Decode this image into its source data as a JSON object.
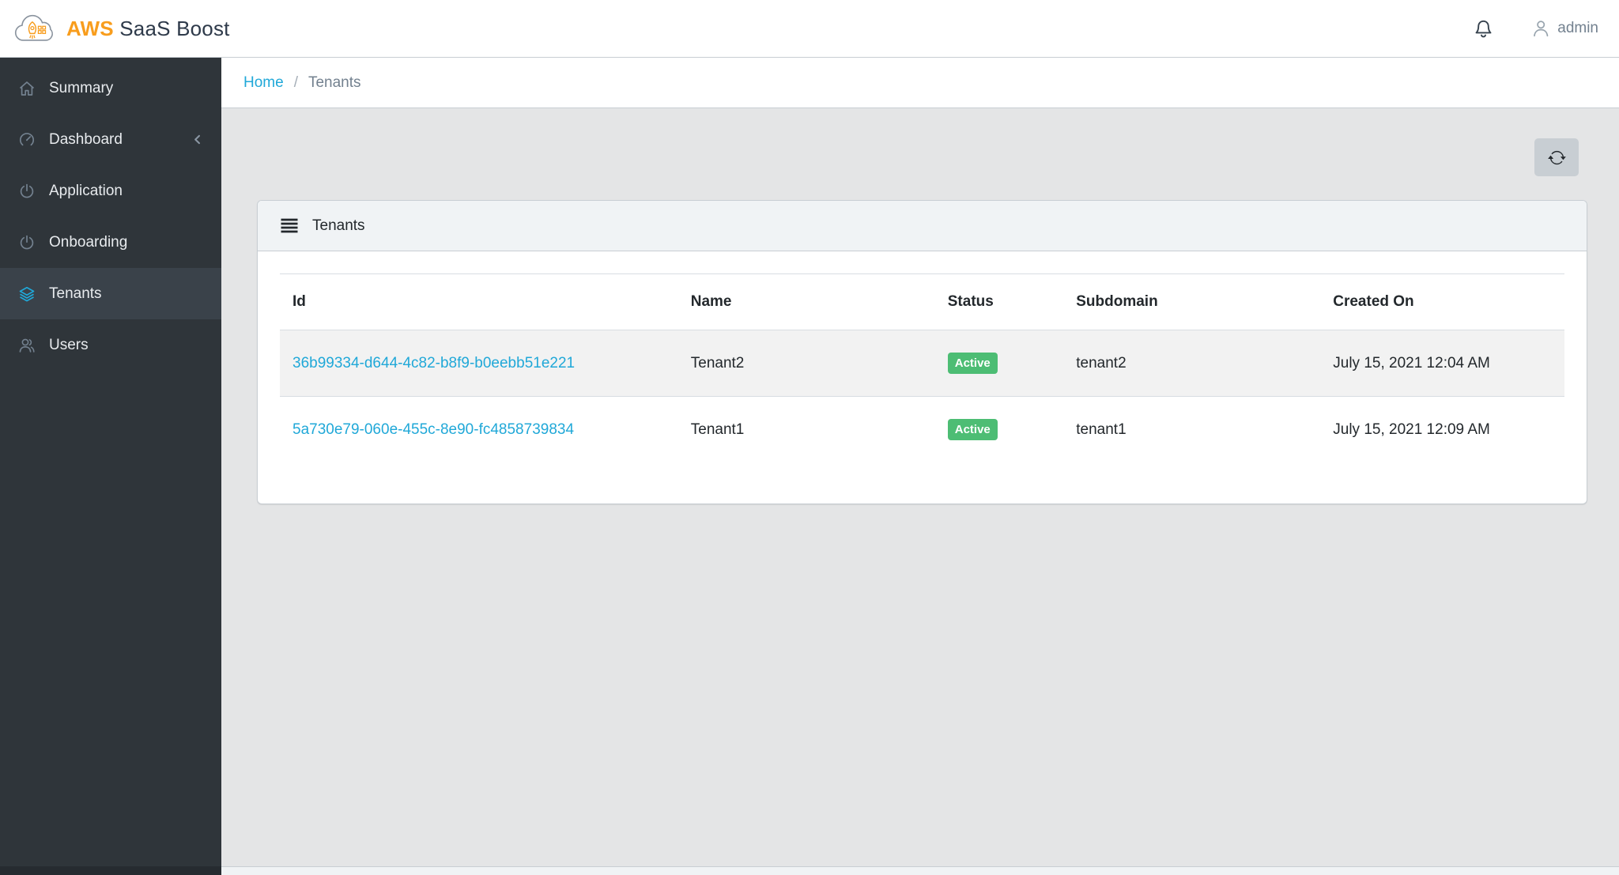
{
  "header": {
    "brand": {
      "prefix": "AWS",
      "name": "SaaS Boost"
    },
    "user_label": "admin"
  },
  "sidebar": {
    "items": [
      {
        "label": "Summary"
      },
      {
        "label": "Dashboard"
      },
      {
        "label": "Application"
      },
      {
        "label": "Onboarding"
      },
      {
        "label": "Tenants"
      },
      {
        "label": "Users"
      }
    ],
    "active_item": "Tenants"
  },
  "breadcrumb": {
    "home": "Home",
    "separator": "/",
    "current": "Tenants"
  },
  "tenants_card": {
    "title": "Tenants"
  },
  "table": {
    "columns": [
      "Id",
      "Name",
      "Status",
      "Subdomain",
      "Created On"
    ],
    "rows": [
      {
        "id": "36b99334-d644-4c82-b8f9-b0eebb51e221",
        "name": "Tenant2",
        "status": "Active",
        "subdomain": "tenant2",
        "created_on": "July 15, 2021 12:04 AM"
      },
      {
        "id": "5a730e79-060e-455c-8e90-fc4858739834",
        "name": "Tenant1",
        "status": "Active",
        "subdomain": "tenant1",
        "created_on": "July 15, 2021 12:09 AM"
      }
    ]
  },
  "colors": {
    "accent": "#20a8d8",
    "success": "#4dbd74",
    "brand_orange": "#f89d1d",
    "sidebar_bg": "#2f353a",
    "main_bg": "#e4e5e6"
  }
}
